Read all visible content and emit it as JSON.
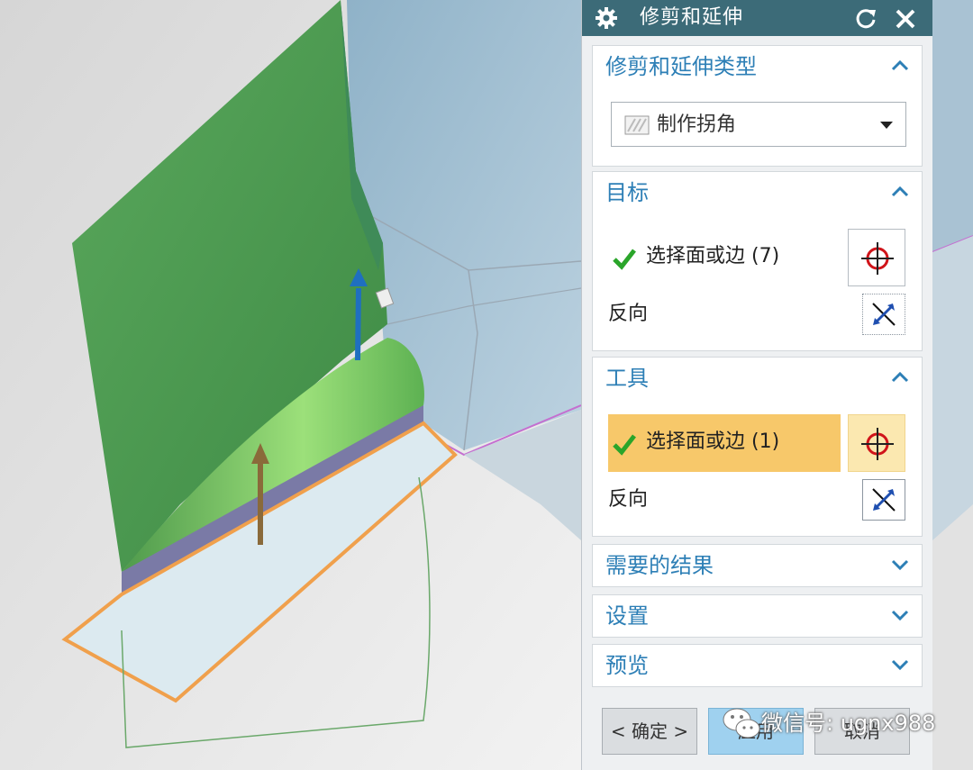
{
  "dialog": {
    "title": "修剪和延伸",
    "icons": {
      "settings": "gear-icon",
      "reset": "reset-icon",
      "close": "close-icon"
    }
  },
  "sections": {
    "type": {
      "title": "修剪和延伸类型",
      "dropdown_value": "制作拐角",
      "expanded": true
    },
    "target": {
      "title": "目标",
      "select_label": "选择面或边 (7)",
      "reverse_label": "反向",
      "expanded": true
    },
    "tool": {
      "title": "工具",
      "select_label": "选择面或边 (1)",
      "reverse_label": "反向",
      "expanded": true,
      "highlighted": true
    },
    "results": {
      "title": "需要的结果",
      "expanded": false
    },
    "settings": {
      "title": "设置",
      "expanded": false
    },
    "preview": {
      "title": "预览",
      "expanded": false
    }
  },
  "buttons": {
    "ok": "< 确定 >",
    "apply": "应用",
    "cancel": "取消"
  },
  "watermark": {
    "text": "微信号: ugnx988"
  },
  "colors": {
    "title_bar": "#3c6b78",
    "section_title": "#2d7fb6",
    "highlight": "#f7c86a",
    "check": "#2aa52a",
    "crosshair": "#d0141a",
    "apply_button": "#9fd1ef",
    "model_green": "#4f9a52",
    "edge_orange": "#f0a04c"
  }
}
